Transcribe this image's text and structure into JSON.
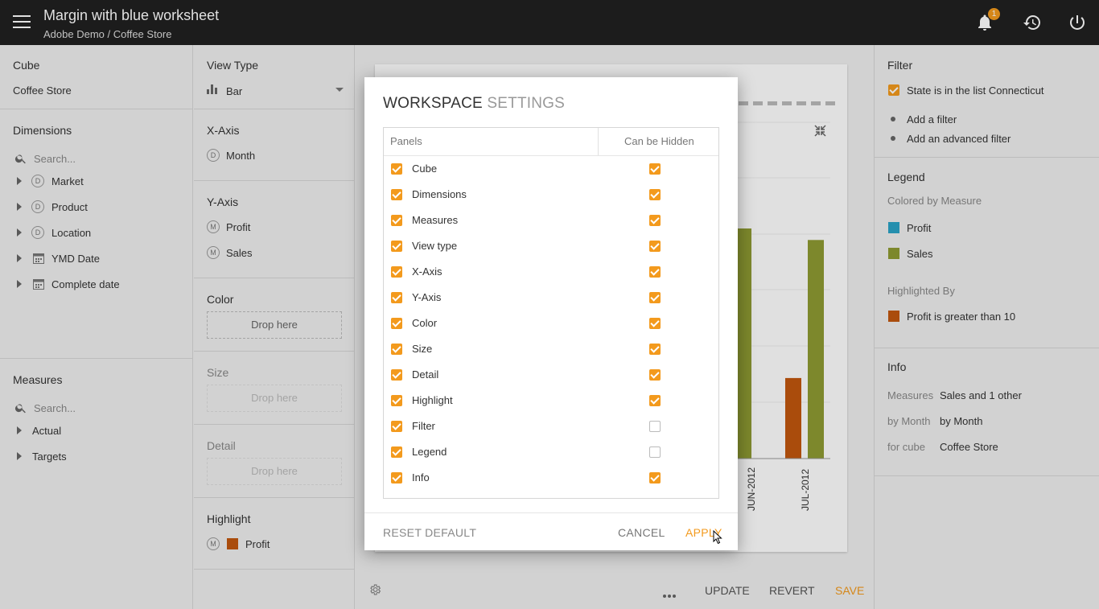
{
  "header": {
    "title": "Margin with blue worksheet",
    "breadcrumb": "Adobe Demo / Coffee Store",
    "notification_count": "1"
  },
  "cube": {
    "title": "Cube",
    "value": "Coffee Store"
  },
  "dimensions": {
    "title": "Dimensions",
    "search_placeholder": "Search...",
    "items": [
      {
        "label": "Market",
        "type": "D"
      },
      {
        "label": "Product",
        "type": "D"
      },
      {
        "label": "Location",
        "type": "D"
      },
      {
        "label": "YMD Date",
        "type": "calendar-icon"
      },
      {
        "label": "Complete date",
        "type": "calendar-icon"
      }
    ]
  },
  "measures": {
    "title": "Measures",
    "search_placeholder": "Search...",
    "items": [
      {
        "label": "Actual"
      },
      {
        "label": "Targets"
      }
    ]
  },
  "view_type": {
    "title": "View Type",
    "value": "Bar"
  },
  "x_axis": {
    "title": "X-Axis",
    "items": [
      {
        "badge": "D",
        "label": "Month"
      }
    ]
  },
  "y_axis": {
    "title": "Y-Axis",
    "items": [
      {
        "badge": "M",
        "label": "Profit"
      },
      {
        "badge": "M",
        "label": "Sales"
      }
    ]
  },
  "color_panel": {
    "title": "Color",
    "drop": "Drop here"
  },
  "size_panel": {
    "title": "Size",
    "drop": "Drop here"
  },
  "detail_panel": {
    "title": "Detail",
    "drop": "Drop here"
  },
  "highlight_panel": {
    "title": "Highlight",
    "badge": "M",
    "label": "Profit",
    "color": "#c2570e"
  },
  "filter": {
    "title": "Filter",
    "active": "State is in the list Connecticut",
    "add_filter": "Add a filter",
    "add_advanced": "Add an advanced filter"
  },
  "legend": {
    "title": "Legend",
    "colored_by": "Colored by Measure",
    "items": [
      {
        "label": "Profit",
        "color": "#2ba3c7"
      },
      {
        "label": "Sales",
        "color": "#8f9b33"
      }
    ],
    "highlighted_by": "Highlighted By",
    "highlight_item": {
      "label": "Profit is greater than 10",
      "color": "#c2570e"
    }
  },
  "info": {
    "title": "Info",
    "rows": [
      {
        "key": "Measures",
        "value": "Sales and 1 other"
      },
      {
        "key": "by Month",
        "value": "by Month"
      },
      {
        "key": "for cube",
        "value": "Coffee Store"
      }
    ]
  },
  "bottom_bar": {
    "update": "UPDATE",
    "revert": "REVERT",
    "save": "SAVE"
  },
  "chart_data": {
    "type": "bar",
    "categories": [
      "JUN-2012",
      "JUL-2012"
    ],
    "series": [
      {
        "name": "Profit",
        "values": [
          0.36,
          0.35
        ],
        "color": "#c2570e"
      },
      {
        "name": "Sales",
        "values": [
          1.0,
          0.95
        ],
        "color": "#8f9b33"
      }
    ]
  },
  "dialog": {
    "title_main": "WORKSPACE",
    "title_sub": "SETTINGS",
    "col_panels": "Panels",
    "col_hidden": "Can be Hidden",
    "rows": [
      {
        "label": "Cube",
        "checked": true,
        "hidden": true
      },
      {
        "label": "Dimensions",
        "checked": true,
        "hidden": true
      },
      {
        "label": "Measures",
        "checked": true,
        "hidden": true
      },
      {
        "label": "View type",
        "checked": true,
        "hidden": true
      },
      {
        "label": "X-Axis",
        "checked": true,
        "hidden": true
      },
      {
        "label": "Y-Axis",
        "checked": true,
        "hidden": true
      },
      {
        "label": "Color",
        "checked": true,
        "hidden": true
      },
      {
        "label": "Size",
        "checked": true,
        "hidden": true
      },
      {
        "label": "Detail",
        "checked": true,
        "hidden": true
      },
      {
        "label": "Highlight",
        "checked": true,
        "hidden": true
      },
      {
        "label": "Filter",
        "checked": true,
        "hidden": false
      },
      {
        "label": "Legend",
        "checked": true,
        "hidden": false
      },
      {
        "label": "Info",
        "checked": true,
        "hidden": true
      }
    ],
    "reset": "RESET DEFAULT",
    "cancel": "CANCEL",
    "apply": "APPLY"
  },
  "colors": {
    "accent": "#f39a1d",
    "link": "#3d86d0",
    "header_bg": "#202020"
  }
}
